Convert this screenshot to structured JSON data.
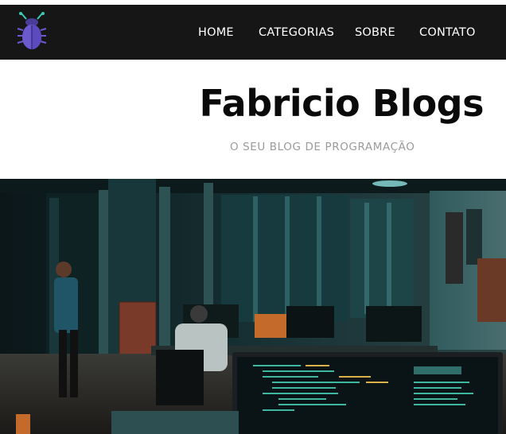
{
  "nav": {
    "logo_icon": "bug-icon",
    "items": [
      {
        "label": "HOME"
      },
      {
        "label": "CATEGORIAS"
      },
      {
        "label": "SOBRE"
      },
      {
        "label": "CONTATO"
      }
    ]
  },
  "header": {
    "title": "Fabricio Blogs",
    "subtitle": "O SEU BLOG DE PROGRAMAÇÃO"
  },
  "hero": {
    "image_icon": "office-coding-photo"
  },
  "colors": {
    "navbar_bg": "#161616",
    "logo_purple": "#6a5acd",
    "logo_antenna": "#3ec9b5",
    "subtitle_gray": "#9a9a9a"
  }
}
